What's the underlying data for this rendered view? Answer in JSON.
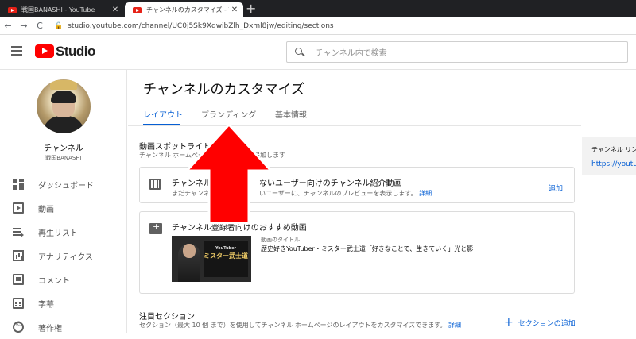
{
  "browser": {
    "tabs": [
      {
        "title": "戦国BANASHI - YouTube",
        "active": false
      },
      {
        "title": "チャンネルのカスタマイズ - YouTube S",
        "active": true
      }
    ],
    "new_tab": "+",
    "url": "studio.youtube.com/channel/UC0j5Sk9XqwibZlh_Dxml8jw/editing/sections"
  },
  "header": {
    "brand": "Studio",
    "search_placeholder": "チャンネル内で検索"
  },
  "sidebar": {
    "channel_title": "チャンネル",
    "channel_name": "戦国BANASHI",
    "items": [
      {
        "label": "ダッシュボード",
        "icon": "dashboard-icon"
      },
      {
        "label": "動画",
        "icon": "video-icon"
      },
      {
        "label": "再生リスト",
        "icon": "playlist-icon"
      },
      {
        "label": "アナリティクス",
        "icon": "analytics-icon"
      },
      {
        "label": "コメント",
        "icon": "comment-icon"
      },
      {
        "label": "字幕",
        "icon": "subtitles-icon"
      },
      {
        "label": "著作権",
        "icon": "copyright-icon"
      }
    ]
  },
  "main": {
    "title": "チャンネルのカスタマイズ",
    "tabs": [
      {
        "label": "レイアウト",
        "active": true
      },
      {
        "label": "ブランディング",
        "active": false
      },
      {
        "label": "基本情報",
        "active": false
      }
    ],
    "spotlight": {
      "title": "動画スポットライト",
      "desc_left": "チャンネル ホームペー",
      "desc_right": "を追加します"
    },
    "card_trailer": {
      "title_left": "チャンネル",
      "title_right": "ないユーザー向けのチャンネル紹介動画",
      "desc_left": "まだチャンネ",
      "desc_right": "いユーザーに、チャンネルのプレビューを表示します。",
      "details_link": "詳細",
      "add": "追加"
    },
    "card_featured": {
      "title": "チャンネル登録者向けのおすすめ動画",
      "video_label": "動画のタイトル",
      "video_title": "歴史好きYouTuber・ミスター武士道「好きなことで、生きていく」光と影",
      "thumb_small": "YouTuber",
      "thumb_big": "ミスター武士道"
    },
    "featured_sections": {
      "title": "注目セクション",
      "desc": "セクション（最大 10 個 まで）を使用してチャンネル ホームページのレイアウトをカスタマイズできます。",
      "details_link": "詳細",
      "add": "セクションの追加"
    }
  },
  "right_panel": {
    "title": "チャンネル リン",
    "link": "https://youtub"
  },
  "colors": {
    "accent": "#065fd4",
    "brand": "#ff0000",
    "arrow": "#ff0000"
  }
}
